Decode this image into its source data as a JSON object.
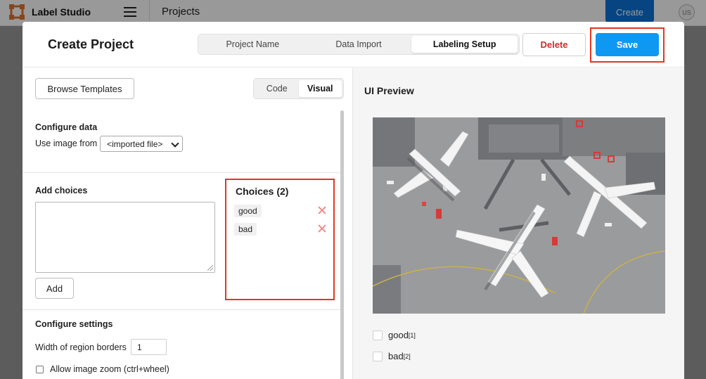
{
  "app": {
    "name": "Label Studio",
    "breadcrumb": "Projects",
    "create_label": "Create",
    "avatar_initials": "US"
  },
  "modal": {
    "title": "Create Project",
    "steps": [
      {
        "label": "Project Name",
        "active": false
      },
      {
        "label": "Data Import",
        "active": false
      },
      {
        "label": "Labeling Setup",
        "active": true
      }
    ],
    "delete_label": "Delete",
    "save_label": "Save"
  },
  "config": {
    "browse_templates_label": "Browse Templates",
    "mode_toggle": [
      {
        "label": "Code",
        "active": false
      },
      {
        "label": "Visual",
        "active": true
      }
    ],
    "configure_data": {
      "title": "Configure data",
      "use_image_label": "Use image from",
      "image_source_value": "<imported file>"
    },
    "add_choices": {
      "title": "Add choices",
      "textarea_value": "",
      "add_label": "Add"
    },
    "choices": {
      "title": "Choices (2)",
      "items": [
        "good",
        "bad"
      ]
    },
    "configure_settings": {
      "title": "Configure settings",
      "border_width_label": "Width of region borders",
      "border_width_value": "1",
      "zoom_label": "Allow image zoom (ctrl+wheel)",
      "zoom_checked": false
    }
  },
  "preview": {
    "title": "UI Preview",
    "choices": [
      {
        "label": "good",
        "hotkey": "[1]"
      },
      {
        "label": "bad",
        "hotkey": "[2]"
      }
    ]
  },
  "colors": {
    "primary": "#0e98f2",
    "topbar_create": "#0a73d9",
    "danger": "#d12b2b",
    "highlight": "#e2371f",
    "logo": "#e0762f"
  }
}
